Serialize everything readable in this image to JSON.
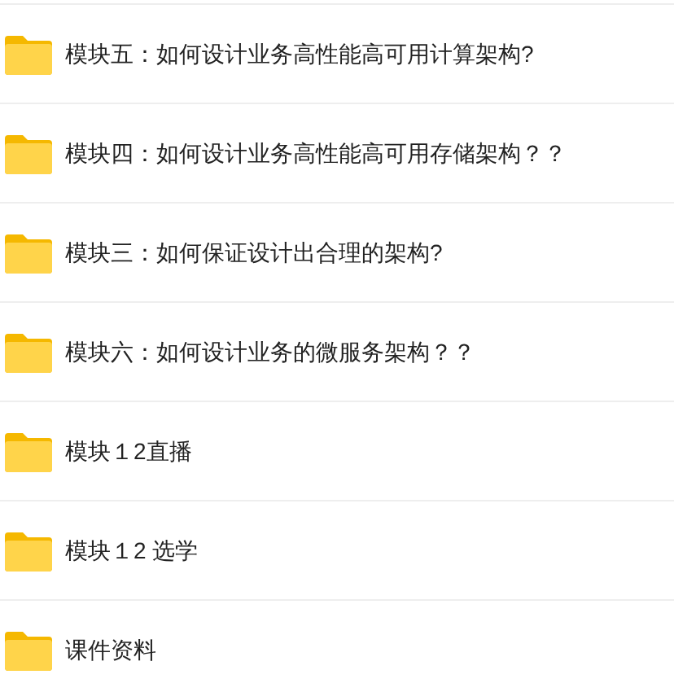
{
  "folders": [
    {
      "name": "模块五：如何设计业务高性能高可用计算架构?"
    },
    {
      "name": "模块四：如何设计业务高性能高可用存储架构？？"
    },
    {
      "name": "模块三：如何保证设计出合理的架构?"
    },
    {
      "name": "模块六：如何设计业务的微服务架构？？"
    },
    {
      "name": "模块１2直播"
    },
    {
      "name": "模块１2 选学"
    },
    {
      "name": "课件资料"
    }
  ]
}
